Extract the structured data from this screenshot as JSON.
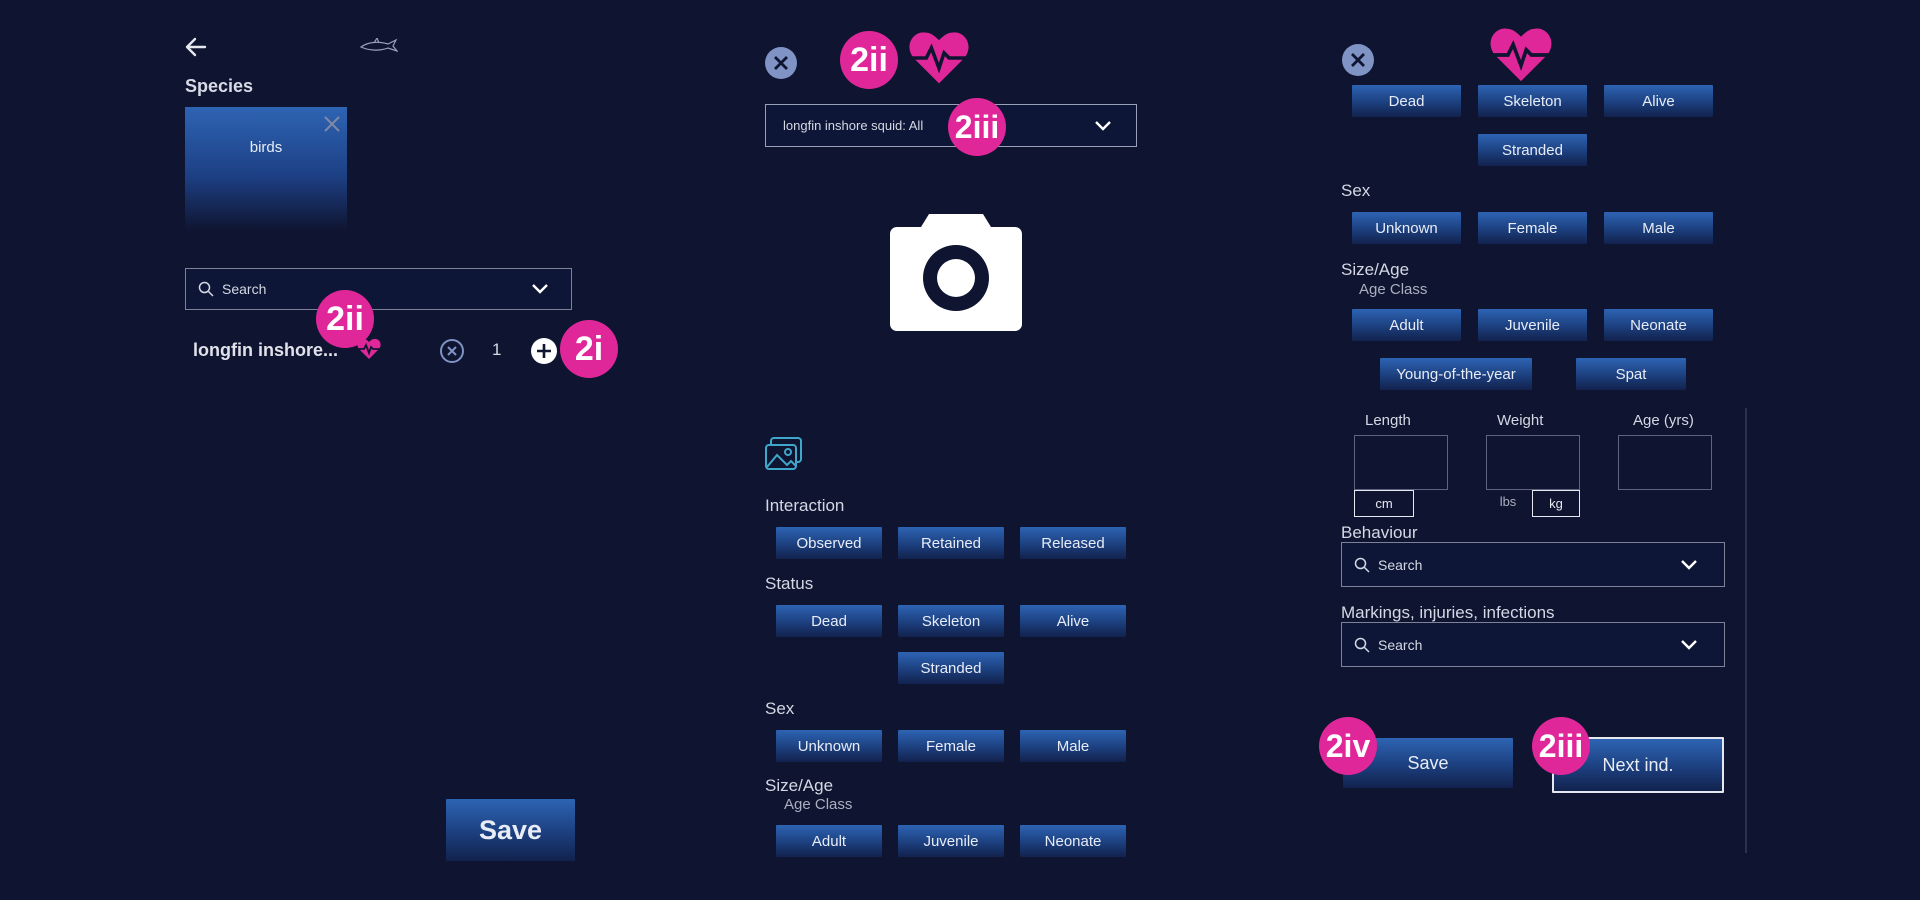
{
  "colors": {
    "background": "#0f1430",
    "accent": "#e0279a",
    "button": "#2e64b3"
  },
  "panel1": {
    "back_icon": "arrow-left-icon",
    "shark_icon": "shark-icon",
    "species_label": "Species",
    "species_card_label": "birds",
    "search_placeholder": "Search",
    "item_name": "longfin inshore...",
    "item_count": "1",
    "save_label": "Save",
    "badge_2ii": "2ii",
    "badge_2i": "2i"
  },
  "panel2": {
    "badge_2ii": "2ii",
    "badge_2iii": "2iii",
    "dropdown_value": "longfin inshore squid: All",
    "interaction_label": "Interaction",
    "interaction_options": [
      "Observed",
      "Retained",
      "Released"
    ],
    "status_label": "Status",
    "status_options": [
      "Dead",
      "Skeleton",
      "Alive",
      "Stranded"
    ],
    "sex_label": "Sex",
    "sex_options": [
      "Unknown",
      "Female",
      "Male"
    ],
    "size_age_label": "Size/Age",
    "age_class_label": "Age Class",
    "age_options": [
      "Adult",
      "Juvenile",
      "Neonate"
    ]
  },
  "panel3": {
    "status_options": [
      "Dead",
      "Skeleton",
      "Alive",
      "Stranded"
    ],
    "sex_label": "Sex",
    "sex_options": [
      "Unknown",
      "Female",
      "Male"
    ],
    "size_age_label": "Size/Age",
    "age_class_label": "Age Class",
    "age_options": [
      "Adult",
      "Juvenile",
      "Neonate",
      "Young-of-the-year",
      "Spat"
    ],
    "length_label": "Length",
    "weight_label": "Weight",
    "age_yrs_label": "Age (yrs)",
    "unit_cm": "cm",
    "unit_lbs": "lbs",
    "unit_kg": "kg",
    "behaviour_label": "Behaviour",
    "behaviour_placeholder": "Search",
    "markings_label": "Markings, injuries, infections",
    "markings_placeholder": "Search",
    "save_label": "Save",
    "next_label": "Next ind.",
    "badge_2iv": "2iv",
    "badge_2iii": "2iii"
  }
}
